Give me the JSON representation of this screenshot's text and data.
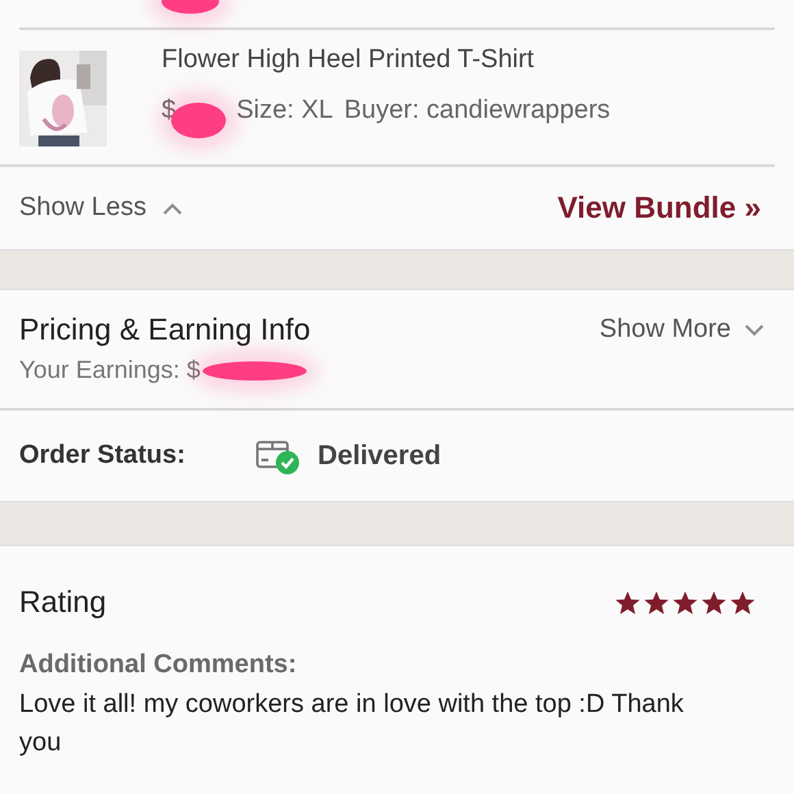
{
  "item": {
    "kind": "picture",
    "title": "Flower High Heel Printed T-Shirt",
    "price": "$",
    "size": "Size: XL",
    "buyer": "Buyer: candiewrappers"
  },
  "bundle": {
    "toggle": "Show Less",
    "expanded": true,
    "link": "View Bundle »"
  },
  "pricing": {
    "title": "Pricing & Earning Info",
    "toggle": "Show More",
    "expanded": false,
    "earnings": "Your Earnings: $"
  },
  "order_status": {
    "label": "Order Status:",
    "value": "Delivered",
    "delivered": true
  },
  "rating": {
    "title": "Rating",
    "stars": 5,
    "comments_label": "Additional Comments:",
    "comment": "Love it all! my coworkers are in love with the top :D Thank you"
  }
}
